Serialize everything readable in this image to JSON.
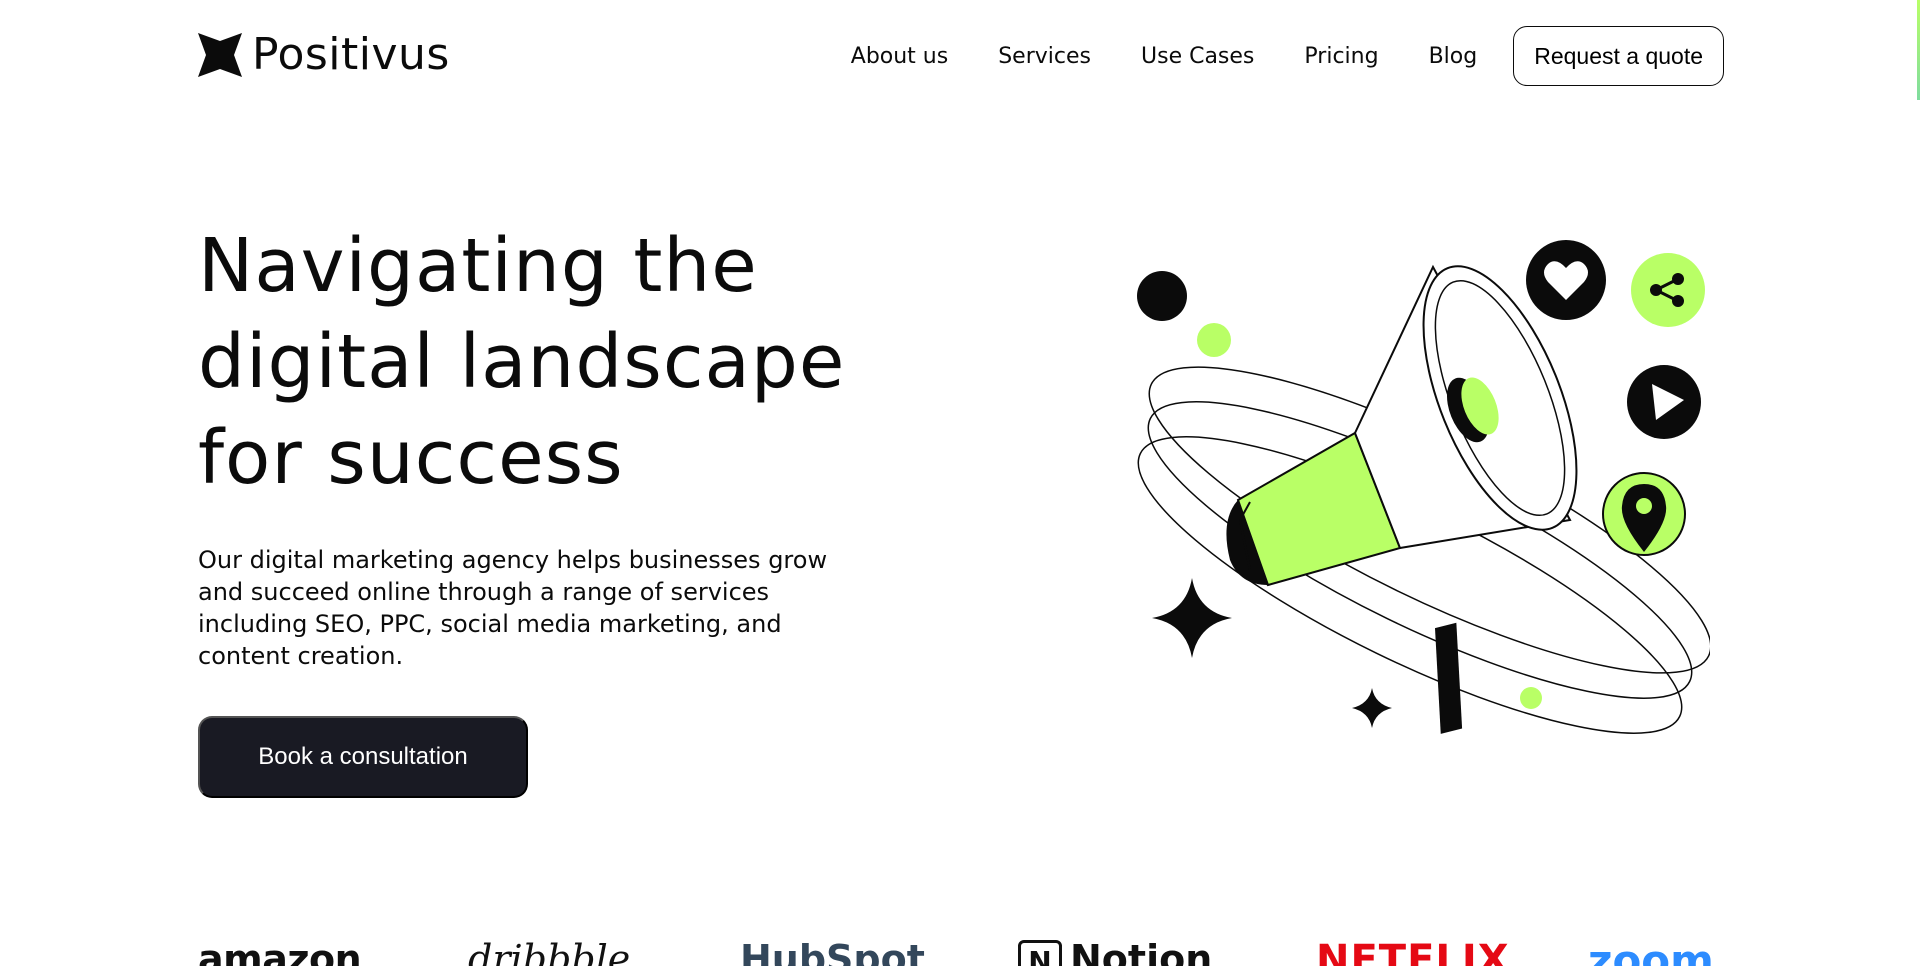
{
  "header": {
    "logo_text": "Positivus",
    "nav": [
      {
        "label": "About us"
      },
      {
        "label": "Services"
      },
      {
        "label": "Use Cases"
      },
      {
        "label": "Pricing"
      },
      {
        "label": "Blog"
      }
    ],
    "quote_button": "Request a quote"
  },
  "hero": {
    "title_line1": "Navigating the",
    "title_line2": "digital landscape",
    "title_line3": "for success",
    "description": "Our digital marketing agency helps businesses grow and succeed online through a range of services including SEO, PPC, social media marketing, and content creation.",
    "cta_button": "Book a consultation"
  },
  "illustration": {
    "icons": [
      "heart-icon",
      "share-icon",
      "play-icon",
      "location-pin-icon",
      "megaphone-icon",
      "sparkle-star-icon"
    ]
  },
  "client_logos": {
    "amazon": "amazon",
    "dribbble": "dribbble",
    "hubspot": "HubSpot",
    "notion": "Notion",
    "netflix": "NETFLIX",
    "zoom": "zoom"
  },
  "colors": {
    "accent_green": "#B9FF66",
    "dark": "#191A23",
    "text": "#0B0B0B",
    "netflix_red": "#E50914",
    "zoom_blue": "#2D8CFF",
    "hubspot_navy": "#33475B",
    "hubspot_orange": "#FF7A59"
  }
}
